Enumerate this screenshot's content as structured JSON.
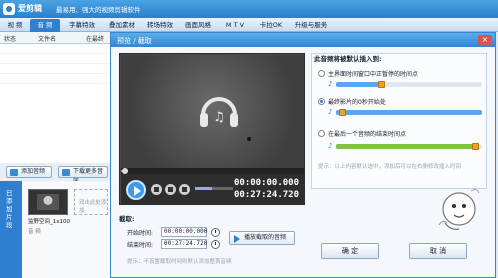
{
  "app": {
    "name": "爱剪辑",
    "slogan": "最易用、强大的视频剪辑软件",
    "tabs": [
      "视 频",
      "音 频",
      "字幕特效",
      "叠加素材",
      "转场特效",
      "画面风格",
      "M T V",
      "卡拉OK",
      "升级与服务"
    ],
    "active_tab": "音 频"
  },
  "list": {
    "columns": [
      "状态",
      "文件名",
      "在最终"
    ],
    "add_audio": "添加音频",
    "download_more": "下载更多音效"
  },
  "timeline": {
    "side_label": "已添加片段",
    "clip_label": "监野空间_1x100",
    "empty_hint": "双击此处添加",
    "audio_label": "音 频"
  },
  "dialog": {
    "title": "预览 / 截取",
    "player": {
      "current_time": "00:00:00.000",
      "total_time": "00:27:24.720",
      "seek_fraction": 0.02,
      "volume_fraction": 0.45
    },
    "clip_section": {
      "title": "截取:",
      "start_label": "开始时间:",
      "start_value": "00:00:00.000",
      "end_label": "结束时间:",
      "end_value": "00:27:24.720",
      "play_button": "播放截取的音频",
      "hint": "提示：不设置截取时间则默认添加整首音频"
    },
    "insert_section": {
      "title": "此音频将被默认插入到:",
      "options": [
        {
          "label": "主界面时间窗口中正暂停的时间点",
          "selected": false,
          "track_fraction": 0.3
        },
        {
          "label": "最终影片的0秒开始处",
          "selected": true,
          "track_fraction": 0.02
        },
        {
          "label": "在最后一个音频的结束时间点",
          "selected": false,
          "track_fraction": 0.98
        }
      ],
      "hint": "提示：以上内容默认选中，添加后可以在右侧修改插入时间"
    },
    "ok": "确 定",
    "cancel": "取 消"
  },
  "colors": {
    "brand_blue": "#2f7fd0",
    "track_blue": "#5aa6ec",
    "track_green": "#7cc442",
    "knob_orange": "#f0a020"
  }
}
